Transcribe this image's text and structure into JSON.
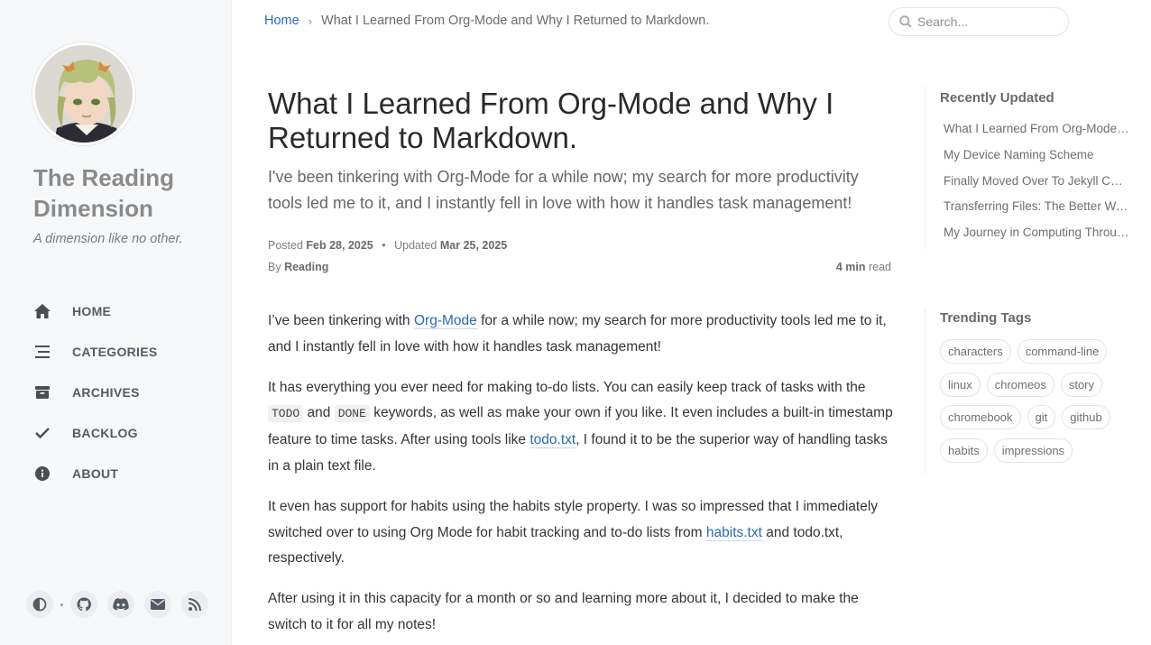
{
  "sidebar": {
    "site_title": "The Reading Dimension",
    "site_subtitle": "A dimension like no other.",
    "nav": [
      {
        "label": "HOME",
        "icon": "home-icon"
      },
      {
        "label": "CATEGORIES",
        "icon": "stream-icon"
      },
      {
        "label": "ARCHIVES",
        "icon": "archive-icon"
      },
      {
        "label": "BACKLOG",
        "icon": "check-icon"
      },
      {
        "label": "ABOUT",
        "icon": "info-icon"
      }
    ],
    "bottom_icons": [
      "theme-toggle-icon",
      "github-icon",
      "discord-icon",
      "email-icon",
      "rss-icon"
    ]
  },
  "topbar": {
    "breadcrumb_home": "Home",
    "breadcrumb_sep": "›",
    "breadcrumb_current": "What I Learned From Org-Mode and Why I Returned to Markdown.",
    "search_placeholder": "Search..."
  },
  "post": {
    "title": "What I Learned From Org-Mode and Why I Returned to Markdown.",
    "description": "I've been tinkering with Org-Mode for a while now; my search for more productivity tools led me to it, and I instantly fell in love with how it handles task management!",
    "posted_label": "Posted",
    "posted_date": "Feb 28, 2025",
    "dot": "•",
    "updated_label": "Updated",
    "updated_date": "Mar 25, 2025",
    "by_label": "By",
    "author": "Reading",
    "read_time": "4 min",
    "read_label": "read",
    "p1": {
      "t1": "I’ve been tinkering with ",
      "link": "Org-Mode",
      "t2": " for a while now; my search for more productivity tools led me to it, and I instantly fell in love with how it handles task management!"
    },
    "p2": {
      "t1": "It has everything you ever need for making to-do lists. You can easily keep track of tasks with the ",
      "code1": "TODO",
      "t2": " and ",
      "code2": "DONE",
      "t3": " keywords, as well as make your own if you like. It even includes a built-in timestamp feature to time tasks. After using tools like ",
      "link": "todo.txt",
      "t4": ", I found it to be the superior way of handling tasks in a plain text file."
    },
    "p3": {
      "t1": "It even has support for habits using the habits style property. I was so impressed that I immediately switched over to using Org Mode for habit tracking and to-do lists from ",
      "link": "habits.txt",
      "t2": " and todo.txt, respectively."
    },
    "p4": "After using it in this capacity for a month or so and learning more about it, I decided to make the switch to it for all my notes!"
  },
  "recently_updated": {
    "title": "Recently Updated",
    "items": [
      "What I Learned From Org-Mode and Why I Returned to Markdown.",
      "My Device Naming Scheme",
      "Finally Moved Over To Jekyll Chirpy",
      "Transferring Files: The Better Way!",
      "My Journey in Computing Through the Years"
    ]
  },
  "trending_tags": {
    "title": "Trending Tags",
    "tags": [
      "characters",
      "command-line",
      "linux",
      "chromeos",
      "story",
      "chromebook",
      "git",
      "github",
      "habits",
      "impressions"
    ]
  }
}
